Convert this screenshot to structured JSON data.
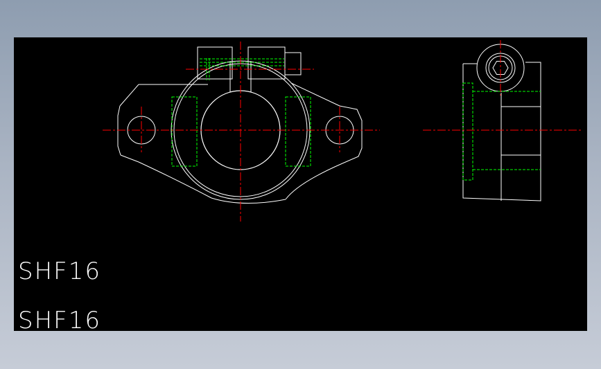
{
  "drawing": {
    "labels": [
      "SHF16",
      "SHF16"
    ],
    "colors": {
      "background": "#000000",
      "outline": "#ffffff",
      "hidden_lines": "#00ff00",
      "center_lines": "#ff0000"
    }
  }
}
